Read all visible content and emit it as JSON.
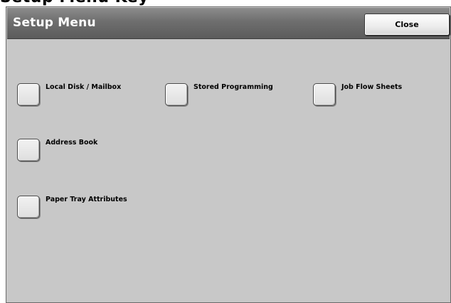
{
  "page_heading": "Setup Menu Key",
  "header": {
    "title": "Setup Menu",
    "close_label": "Close"
  },
  "menu": {
    "items": [
      {
        "label": "Local Disk / Mailbox"
      },
      {
        "label": "Stored Programming"
      },
      {
        "label": "Job Flow Sheets"
      },
      {
        "label": "Address Book"
      },
      {
        "label": "Paper Tray Attributes"
      }
    ]
  },
  "colors": {
    "panel_background": "#c8c8c8",
    "title_bar": "#6e6e6e",
    "title_text": "#ffffff"
  }
}
